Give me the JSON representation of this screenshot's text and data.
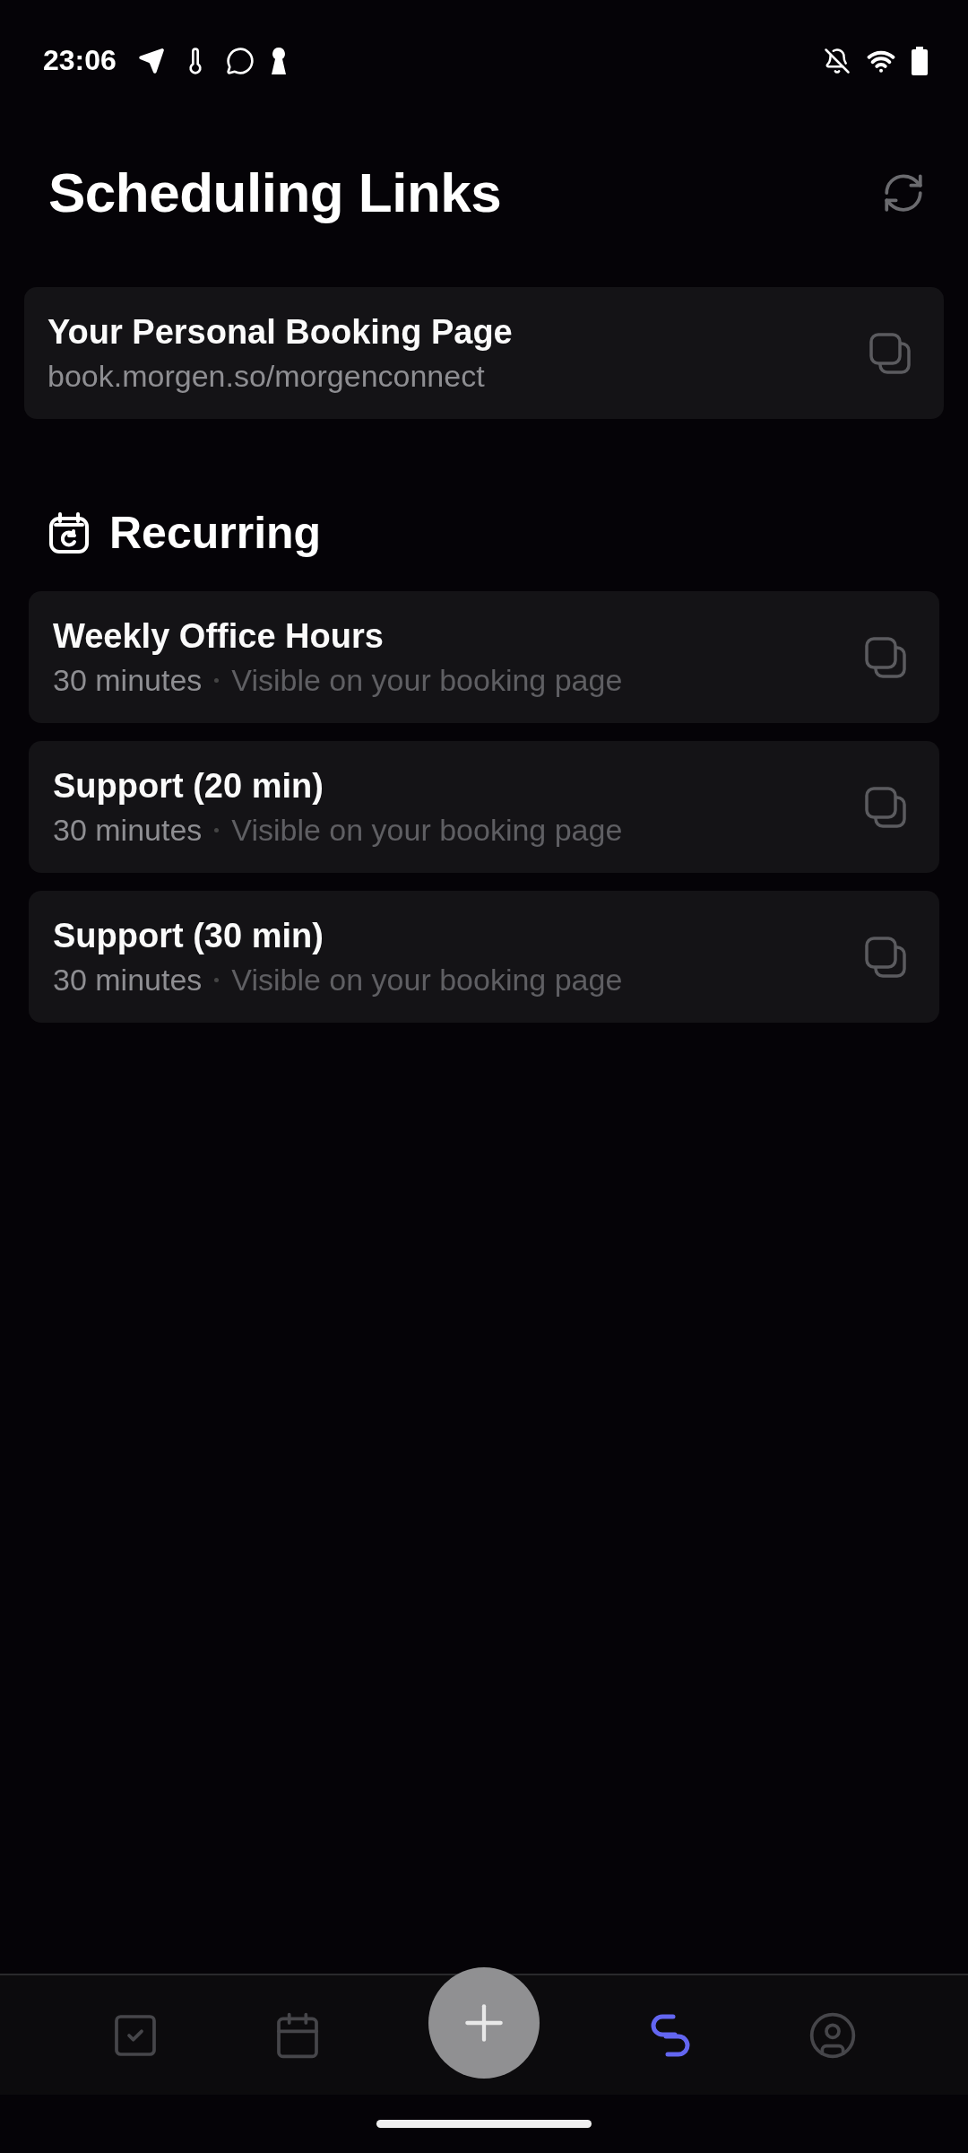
{
  "status_bar": {
    "time": "23:06"
  },
  "header": {
    "title": "Scheduling Links"
  },
  "personal_page": {
    "title": "Your Personal Booking Page",
    "url": "book.morgen.so/morgenconnect"
  },
  "section": {
    "title": "Recurring"
  },
  "links": [
    {
      "title": "Weekly Office Hours",
      "duration": "30 minutes",
      "visibility": "Visible on your booking page"
    },
    {
      "title": "Support (20 min)",
      "duration": "30 minutes",
      "visibility": "Visible on your booking page"
    },
    {
      "title": "Support (30 min)",
      "duration": "30 minutes",
      "visibility": "Visible on your booking page"
    }
  ],
  "bottom_nav": {
    "tabs": [
      {
        "selected": false
      },
      {
        "selected": false
      },
      {
        "selected": true
      },
      {
        "selected": false
      }
    ]
  }
}
